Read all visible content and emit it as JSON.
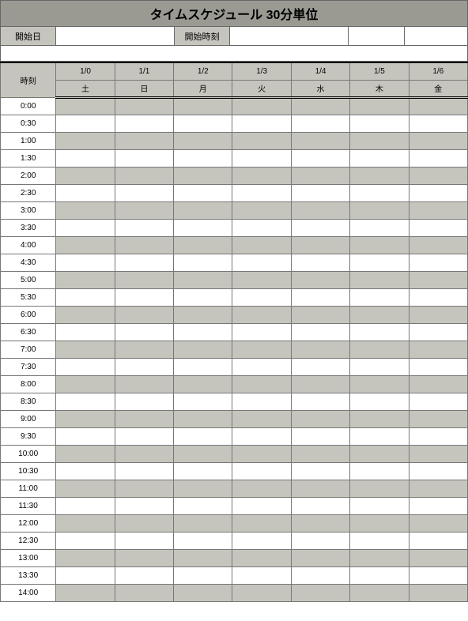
{
  "title": "タイムスケジュール 30分単位",
  "inputs": {
    "start_date_label": "開始日",
    "start_time_label": "開始時刻"
  },
  "header": {
    "time_label": "時刻",
    "dates": [
      "1/0",
      "1/1",
      "1/2",
      "1/3",
      "1/4",
      "1/5",
      "1/6"
    ],
    "weekdays": [
      "土",
      "日",
      "月",
      "火",
      "水",
      "木",
      "金"
    ]
  },
  "times": [
    "0:00",
    "0:30",
    "1:00",
    "1:30",
    "2:00",
    "2:30",
    "3:00",
    "3:30",
    "4:00",
    "4:30",
    "5:00",
    "5:30",
    "6:00",
    "6:30",
    "7:00",
    "7:30",
    "8:00",
    "8:30",
    "9:00",
    "9:30",
    "10:00",
    "10:30",
    "11:00",
    "11:30",
    "12:00",
    "12:30",
    "13:00",
    "13:30",
    "14:00"
  ]
}
